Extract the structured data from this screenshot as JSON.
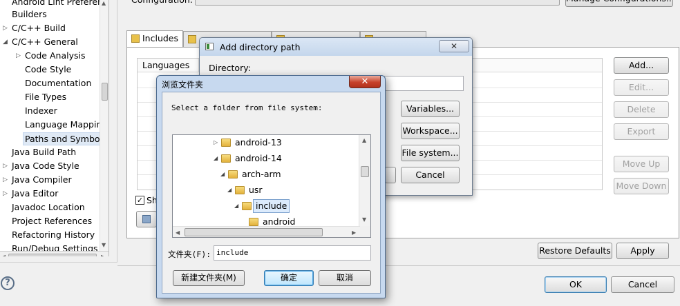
{
  "tree": {
    "items": [
      {
        "label": "Android Lint Preferen",
        "arrow": ""
      },
      {
        "label": "Builders",
        "arrow": ""
      },
      {
        "label": "C/C++ Build",
        "arrow": "▷"
      },
      {
        "label": "C/C++ General",
        "arrow": "◢"
      },
      {
        "label": "Code Analysis",
        "arrow": "▷"
      },
      {
        "label": "Code Style",
        "arrow": ""
      },
      {
        "label": "Documentation",
        "arrow": ""
      },
      {
        "label": "File Types",
        "arrow": ""
      },
      {
        "label": "Indexer",
        "arrow": ""
      },
      {
        "label": "Language Mappin",
        "arrow": ""
      },
      {
        "label": "Paths and Symbols",
        "arrow": ""
      },
      {
        "label": "Java Build Path",
        "arrow": ""
      },
      {
        "label": "Java Code Style",
        "arrow": "▷"
      },
      {
        "label": "Java Compiler",
        "arrow": "▷"
      },
      {
        "label": "Java Editor",
        "arrow": "▷"
      },
      {
        "label": "Javadoc Location",
        "arrow": ""
      },
      {
        "label": "Project References",
        "arrow": ""
      },
      {
        "label": "Refactoring History",
        "arrow": ""
      },
      {
        "label": "Run/Debug Settings",
        "arrow": ""
      }
    ]
  },
  "config": {
    "label": "Configuration:",
    "manage_label": "Manage Configurations..."
  },
  "tabs": {
    "includes": "Includes"
  },
  "table": {
    "languages_header": "Languages",
    "show_label": "Sh"
  },
  "side_buttons": {
    "add": "Add...",
    "edit": "Edit...",
    "delete": "Delete",
    "export": "Export",
    "move_up": "Move Up",
    "move_down": "Move Down"
  },
  "bottom": {
    "restore_defaults": "Restore Defaults",
    "apply": "Apply",
    "ok": "OK",
    "cancel": "Cancel"
  },
  "add_dialog": {
    "title": "Add directory path",
    "directory_label": "Directory:",
    "variables": "Variables...",
    "workspace": "Workspace...",
    "file_system": "File system...",
    "cancel": "Cancel"
  },
  "browse_dialog": {
    "title": "浏览文件夹",
    "instruction": "Select a folder from file system:",
    "folders": [
      {
        "name": "android-13",
        "arrow": "▷"
      },
      {
        "name": "android-14",
        "arrow": "◢"
      },
      {
        "name": "arch-arm",
        "arrow": "◢"
      },
      {
        "name": "usr",
        "arrow": "◢"
      },
      {
        "name": "include",
        "arrow": "◢"
      },
      {
        "name": "android",
        "arrow": ""
      }
    ],
    "folder_label": "文件夹(F):",
    "folder_value": "include",
    "new_folder": "新建文件夹(M)",
    "confirm": "确定",
    "cancel": "取消"
  }
}
